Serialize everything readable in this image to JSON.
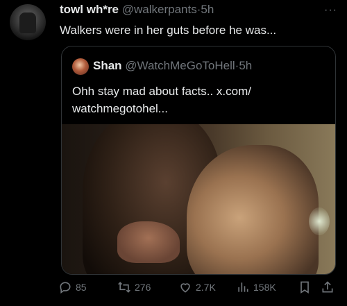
{
  "tweet": {
    "author_name": "towl wh*re",
    "handle": "@walkerpants",
    "separator": "·",
    "time": "5h",
    "text": "Walkers were in her guts before he was...",
    "more": "···"
  },
  "quote": {
    "author_name": "Shan",
    "handle": "@WatchMeGoToHell",
    "separator": "·",
    "time": "5h",
    "text": "Ohh stay mad about facts.. x.com/ watchmegotohel..."
  },
  "actions": {
    "replies": "85",
    "retweets": "276",
    "likes": "2.7K",
    "views": "158K"
  },
  "icons": {
    "reply": "reply-icon",
    "retweet": "retweet-icon",
    "like": "heart-icon",
    "views": "views-icon",
    "bookmark": "bookmark-icon",
    "share": "share-icon"
  },
  "colors": {
    "background": "#000000",
    "text": "#e7e9ea",
    "muted": "#71767b",
    "border": "#2f3336"
  }
}
